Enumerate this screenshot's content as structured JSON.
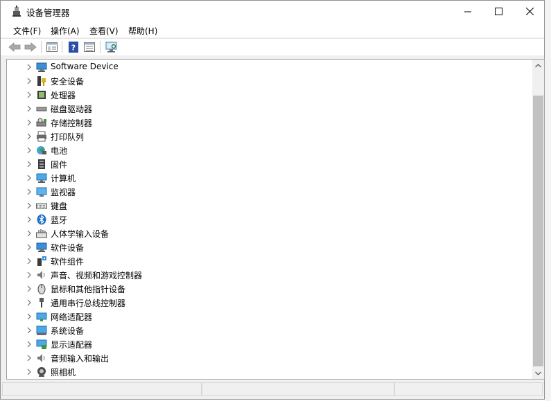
{
  "window": {
    "title": "设备管理器"
  },
  "menu": [
    {
      "label": "文件(F)"
    },
    {
      "label": "操作(A)"
    },
    {
      "label": "查看(V)"
    },
    {
      "label": "帮助(H)"
    }
  ],
  "toolbar": {
    "buttons": [
      "back-icon",
      "forward-icon",
      "properties-view-icon",
      "help-icon",
      "details-view-icon",
      "scan-hardware-icon"
    ]
  },
  "devices": [
    {
      "label": "Software Device",
      "icon": "software-device-icon"
    },
    {
      "label": "安全设备",
      "icon": "security-device-icon"
    },
    {
      "label": "处理器",
      "icon": "processor-icon"
    },
    {
      "label": "磁盘驱动器",
      "icon": "disk-drive-icon"
    },
    {
      "label": "存储控制器",
      "icon": "storage-controller-icon"
    },
    {
      "label": "打印队列",
      "icon": "print-queue-icon"
    },
    {
      "label": "电池",
      "icon": "battery-icon"
    },
    {
      "label": "固件",
      "icon": "firmware-icon"
    },
    {
      "label": "计算机",
      "icon": "computer-icon"
    },
    {
      "label": "监视器",
      "icon": "monitor-icon"
    },
    {
      "label": "键盘",
      "icon": "keyboard-icon"
    },
    {
      "label": "蓝牙",
      "icon": "bluetooth-icon"
    },
    {
      "label": "人体学输入设备",
      "icon": "hid-icon"
    },
    {
      "label": "软件设备",
      "icon": "software-device-icon"
    },
    {
      "label": "软件组件",
      "icon": "software-component-icon"
    },
    {
      "label": "声音、视频和游戏控制器",
      "icon": "sound-icon"
    },
    {
      "label": "鼠标和其他指针设备",
      "icon": "mouse-icon"
    },
    {
      "label": "通用串行总线控制器",
      "icon": "usb-icon"
    },
    {
      "label": "网络适配器",
      "icon": "network-adapter-icon"
    },
    {
      "label": "系统设备",
      "icon": "system-device-icon"
    },
    {
      "label": "显示适配器",
      "icon": "display-adapter-icon"
    },
    {
      "label": "音频输入和输出",
      "icon": "audio-io-icon"
    },
    {
      "label": "照相机",
      "icon": "camera-icon"
    }
  ]
}
